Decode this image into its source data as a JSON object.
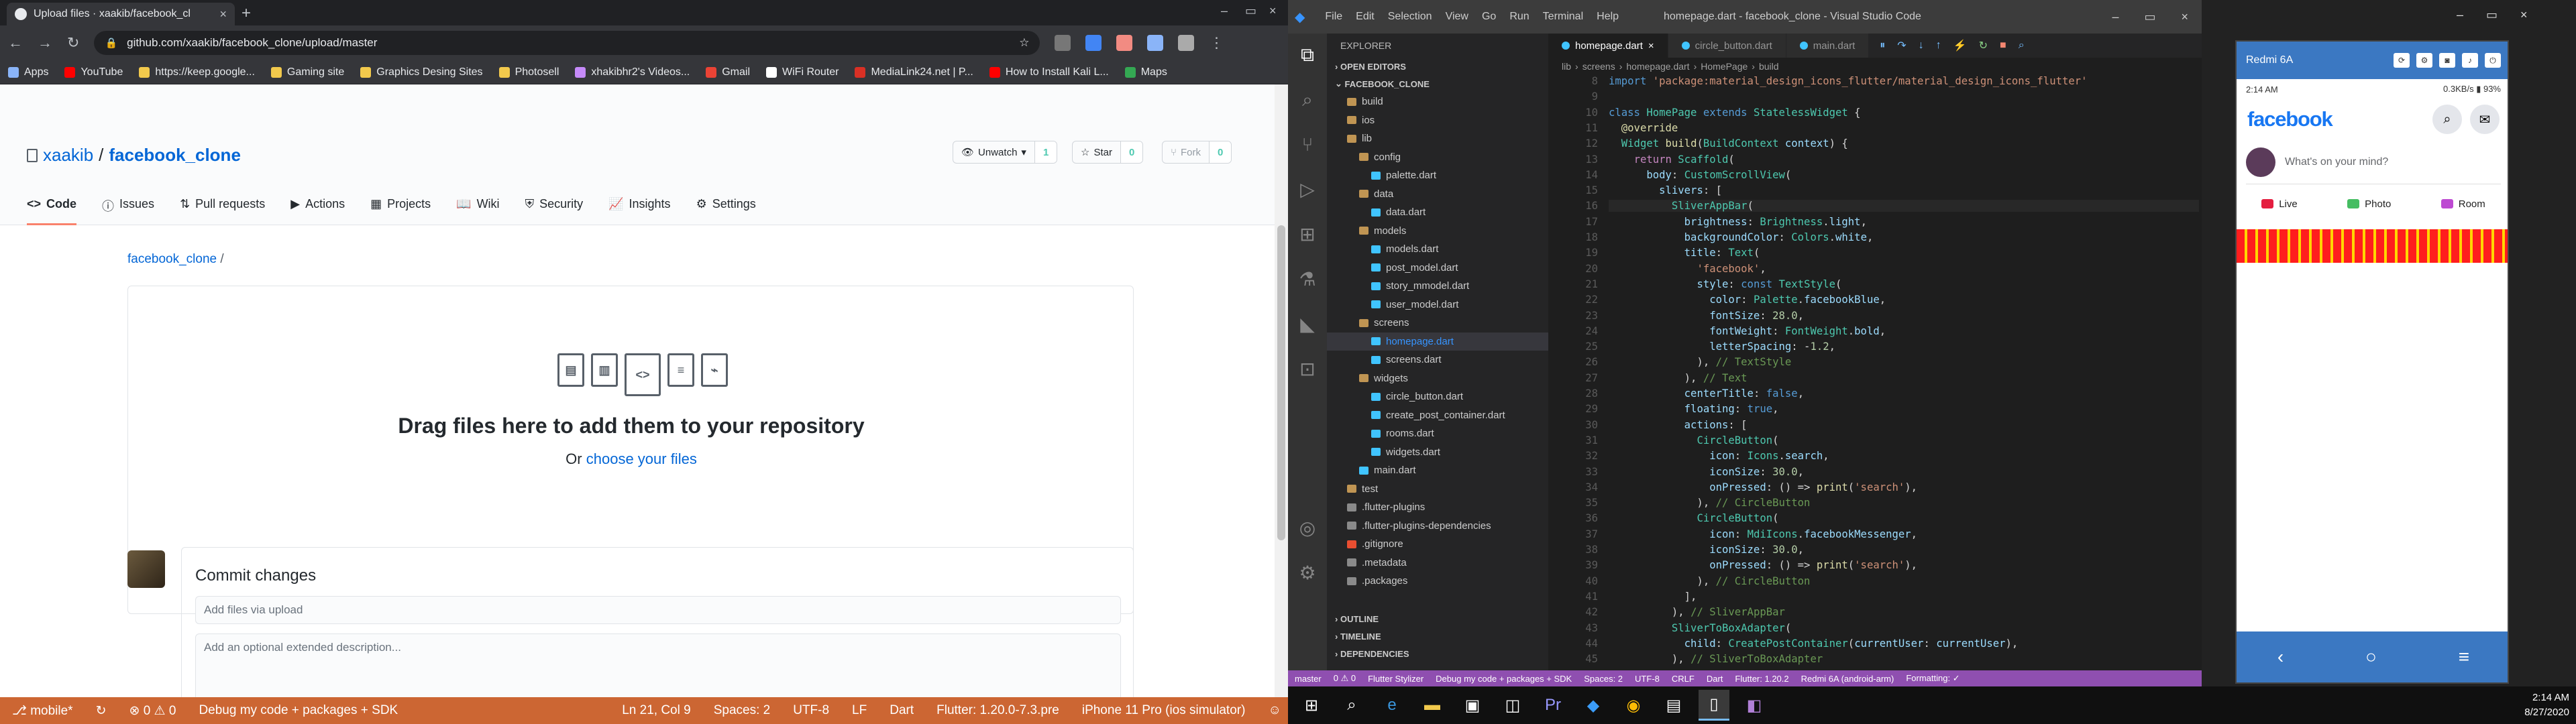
{
  "chrome": {
    "tab_title": "Upload files · xaakib/facebook_cl",
    "url": "github.com/xaakib/facebook_clone/upload/master",
    "bookmarks": [
      "Apps",
      "YouTube",
      "https://keep.google...",
      "Gaming site",
      "Graphics Desing Sites",
      "Photosell",
      "xhakibhr2's Videos...",
      "Gmail",
      "WiFi Router",
      "MediaLink24.net | P...",
      "How to Install Kali L...",
      "Maps"
    ]
  },
  "github": {
    "owner": "xaakib",
    "repo": "facebook_clone",
    "watch_label": "Unwatch",
    "watch_count": "1",
    "star_label": "Star",
    "star_count": "0",
    "fork_label": "Fork",
    "fork_count": "0",
    "tabs": [
      "Code",
      "Issues",
      "Pull requests",
      "Actions",
      "Projects",
      "Wiki",
      "Security",
      "Insights",
      "Settings"
    ],
    "breadcrumb": "facebook_clone",
    "drop_title": "Drag files here to add them to your repository",
    "drop_or": "Or",
    "drop_link": "choose your files",
    "commit_title": "Commit changes",
    "commit_placeholder": "Add files via upload",
    "desc_placeholder": "Add an optional extended description..."
  },
  "left_status": {
    "branch": "mobile*",
    "errors": "0",
    "warnings": "0",
    "debug": "Debug my code + packages + SDK",
    "position": "Ln 21, Col 9",
    "spaces": "Spaces: 2",
    "encoding": "UTF-8",
    "eol": "LF",
    "lang": "Dart",
    "flutter": "Flutter: 1.20.0-7.3.pre",
    "device": "iPhone 11 Pro (ios simulator)"
  },
  "vscode": {
    "menus": [
      "File",
      "Edit",
      "Selection",
      "View",
      "Go",
      "Run",
      "Terminal",
      "Help"
    ],
    "window_title": "homepage.dart - facebook_clone - Visual Studio Code",
    "explorer_label": "EXPLORER",
    "open_editors": "OPEN EDITORS",
    "project": "FACEBOOK_CLONE",
    "tree": [
      {
        "label": "build",
        "indent": 1,
        "type": "folder"
      },
      {
        "label": "ios",
        "indent": 1,
        "type": "folder"
      },
      {
        "label": "lib",
        "indent": 1,
        "type": "folder"
      },
      {
        "label": "config",
        "indent": 2,
        "type": "folder"
      },
      {
        "label": "palette.dart",
        "indent": 3,
        "type": "dart"
      },
      {
        "label": "data",
        "indent": 2,
        "type": "folder"
      },
      {
        "label": "data.dart",
        "indent": 3,
        "type": "dart"
      },
      {
        "label": "models",
        "indent": 2,
        "type": "folder"
      },
      {
        "label": "models.dart",
        "indent": 3,
        "type": "dart"
      },
      {
        "label": "post_model.dart",
        "indent": 3,
        "type": "dart"
      },
      {
        "label": "story_mmodel.dart",
        "indent": 3,
        "type": "dart"
      },
      {
        "label": "user_model.dart",
        "indent": 3,
        "type": "dart"
      },
      {
        "label": "screens",
        "indent": 2,
        "type": "folder"
      },
      {
        "label": "homepage.dart",
        "indent": 3,
        "type": "dart",
        "selected": true
      },
      {
        "label": "screens.dart",
        "indent": 3,
        "type": "dart"
      },
      {
        "label": "widgets",
        "indent": 2,
        "type": "folder"
      },
      {
        "label": "circle_button.dart",
        "indent": 3,
        "type": "dart"
      },
      {
        "label": "create_post_container.dart",
        "indent": 3,
        "type": "dart"
      },
      {
        "label": "rooms.dart",
        "indent": 3,
        "type": "dart"
      },
      {
        "label": "widgets.dart",
        "indent": 3,
        "type": "dart"
      },
      {
        "label": "main.dart",
        "indent": 2,
        "type": "dart"
      },
      {
        "label": "test",
        "indent": 1,
        "type": "folder"
      },
      {
        "label": ".flutter-plugins",
        "indent": 1,
        "type": "file"
      },
      {
        "label": ".flutter-plugins-dependencies",
        "indent": 1,
        "type": "file"
      },
      {
        "label": ".gitignore",
        "indent": 1,
        "type": "git"
      },
      {
        "label": ".metadata",
        "indent": 1,
        "type": "file"
      },
      {
        "label": ".packages",
        "indent": 1,
        "type": "file"
      }
    ],
    "bottom_sections": [
      "OUTLINE",
      "TIMELINE",
      "DEPENDENCIES"
    ],
    "tabs": [
      "homepage.dart",
      "circle_button.dart",
      "main.dart"
    ],
    "breadcrumb": [
      "lib",
      "screens",
      "homepage.dart",
      "HomePage",
      "build"
    ],
    "status": [
      "master",
      "0 ⚠ 0",
      "Flutter Stylizer",
      "Debug my code + packages + SDK",
      "Spaces: 2",
      "UTF-8",
      "CRLF",
      "Dart",
      "Flutter: 1.20.2",
      "Redmi 6A (android-arm)",
      "Formatting: ✓"
    ]
  },
  "emulator": {
    "device_name": "Redmi 6A",
    "time": "2:14 AM",
    "net": "0.3KB/s",
    "battery": "93%",
    "app_title": "facebook",
    "post_hint": "What's on your mind?",
    "buttons": [
      "Live",
      "Photo",
      "Room"
    ]
  },
  "taskbar": {
    "time": "2:14 AM",
    "date": "8/27/2020"
  },
  "colors": {
    "vscode_status": "#cc6633",
    "fb_blue": "#1877f2",
    "emulator_bar": "#3b78c2"
  }
}
